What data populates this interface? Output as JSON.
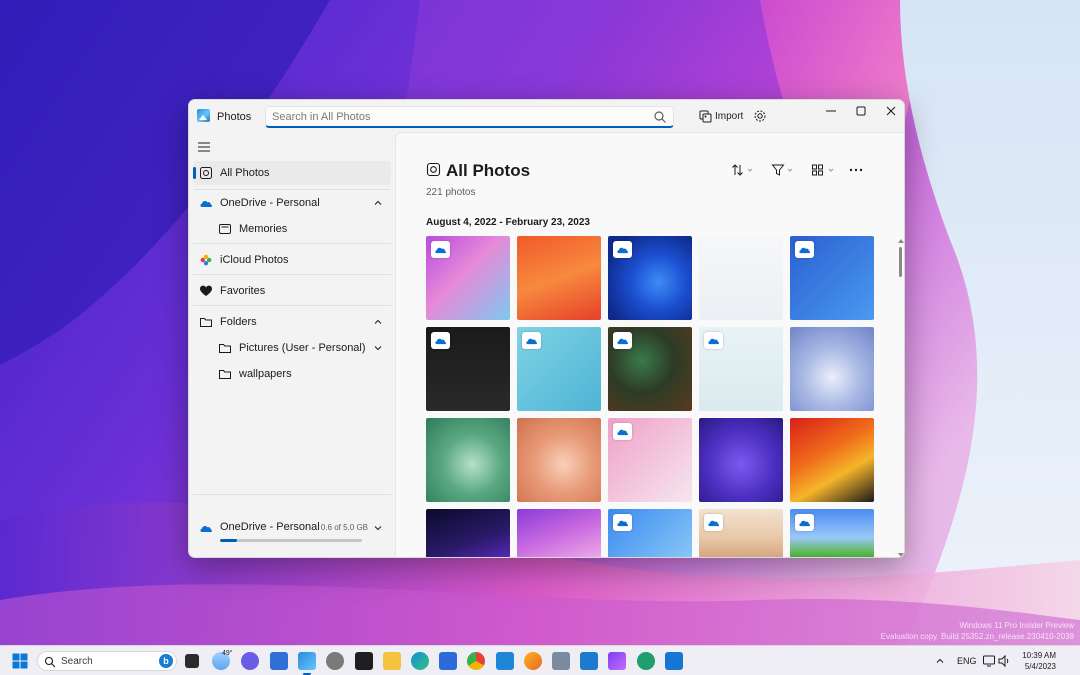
{
  "window": {
    "title": "Photos",
    "search_placeholder": "Search in All Photos",
    "import_label": "Import"
  },
  "sidebar": {
    "items": [
      {
        "label": "All Photos",
        "icon": "all-photos-icon",
        "selected": true
      },
      {
        "label": "OneDrive - Personal",
        "icon": "onedrive-cloud-icon",
        "expanded": true
      },
      {
        "label": "Memories",
        "icon": "memories-icon",
        "sub": true
      },
      {
        "label": "iCloud Photos",
        "icon": "icloud-photos-icon"
      },
      {
        "label": "Favorites",
        "icon": "heart-icon"
      },
      {
        "label": "Folders",
        "icon": "folder-icon",
        "expanded": true
      },
      {
        "label": "Pictures (User - Personal)",
        "icon": "folder-icon",
        "sub": true
      },
      {
        "label": "wallpapers",
        "icon": "folder-icon",
        "sub": true
      }
    ],
    "storage": {
      "label": "OneDrive - Personal",
      "usage": "0.6 of 5.0 GB",
      "used_fraction": 0.12
    }
  },
  "main": {
    "title": "All Photos",
    "count": "221 photos",
    "date_range": "August 4, 2022 - February 23, 2023",
    "photos": [
      {
        "style": "win11-settings",
        "cloud": true
      },
      {
        "style": "arch-logo",
        "cloud": false
      },
      {
        "style": "blue-bloom",
        "cloud": true
      },
      {
        "style": "settings-light",
        "cloud": false
      },
      {
        "style": "explorer-blue",
        "cloud": true
      },
      {
        "style": "explorer-dark-frame",
        "cloud": true
      },
      {
        "style": "explorer-window",
        "cloud": true
      },
      {
        "style": "dark-green-pattern",
        "cloud": true
      },
      {
        "style": "explorer-light",
        "cloud": true
      },
      {
        "style": "lilac-bloom",
        "cloud": false
      },
      {
        "style": "teal-bloom",
        "cloud": false
      },
      {
        "style": "peach-bloom",
        "cloud": false
      },
      {
        "style": "settings-pink",
        "cloud": true
      },
      {
        "style": "purple-hearts",
        "cloud": false
      },
      {
        "style": "orange-waves",
        "cloud": false
      },
      {
        "style": "dark-night",
        "cloud": false
      },
      {
        "style": "purple-wave",
        "cloud": false
      },
      {
        "style": "explorer-blue-2",
        "cloud": true
      },
      {
        "style": "desert-dune",
        "cloud": true
      },
      {
        "style": "bliss-sky",
        "cloud": true
      }
    ]
  },
  "taskbar": {
    "search_label": "Search",
    "weather_temp": "49°",
    "language": "ENG",
    "time": "10:39 AM",
    "date": "5/4/2023"
  },
  "watermark": {
    "line1": "Windows 11 Pro Insider Preview",
    "line2": "Evaluation copy. Build 25352.zn_release.230410-2039"
  },
  "colors": {
    "accent": "#005fb8",
    "window_bg": "#f3f3f3",
    "content_bg": "#f9f9f9"
  }
}
